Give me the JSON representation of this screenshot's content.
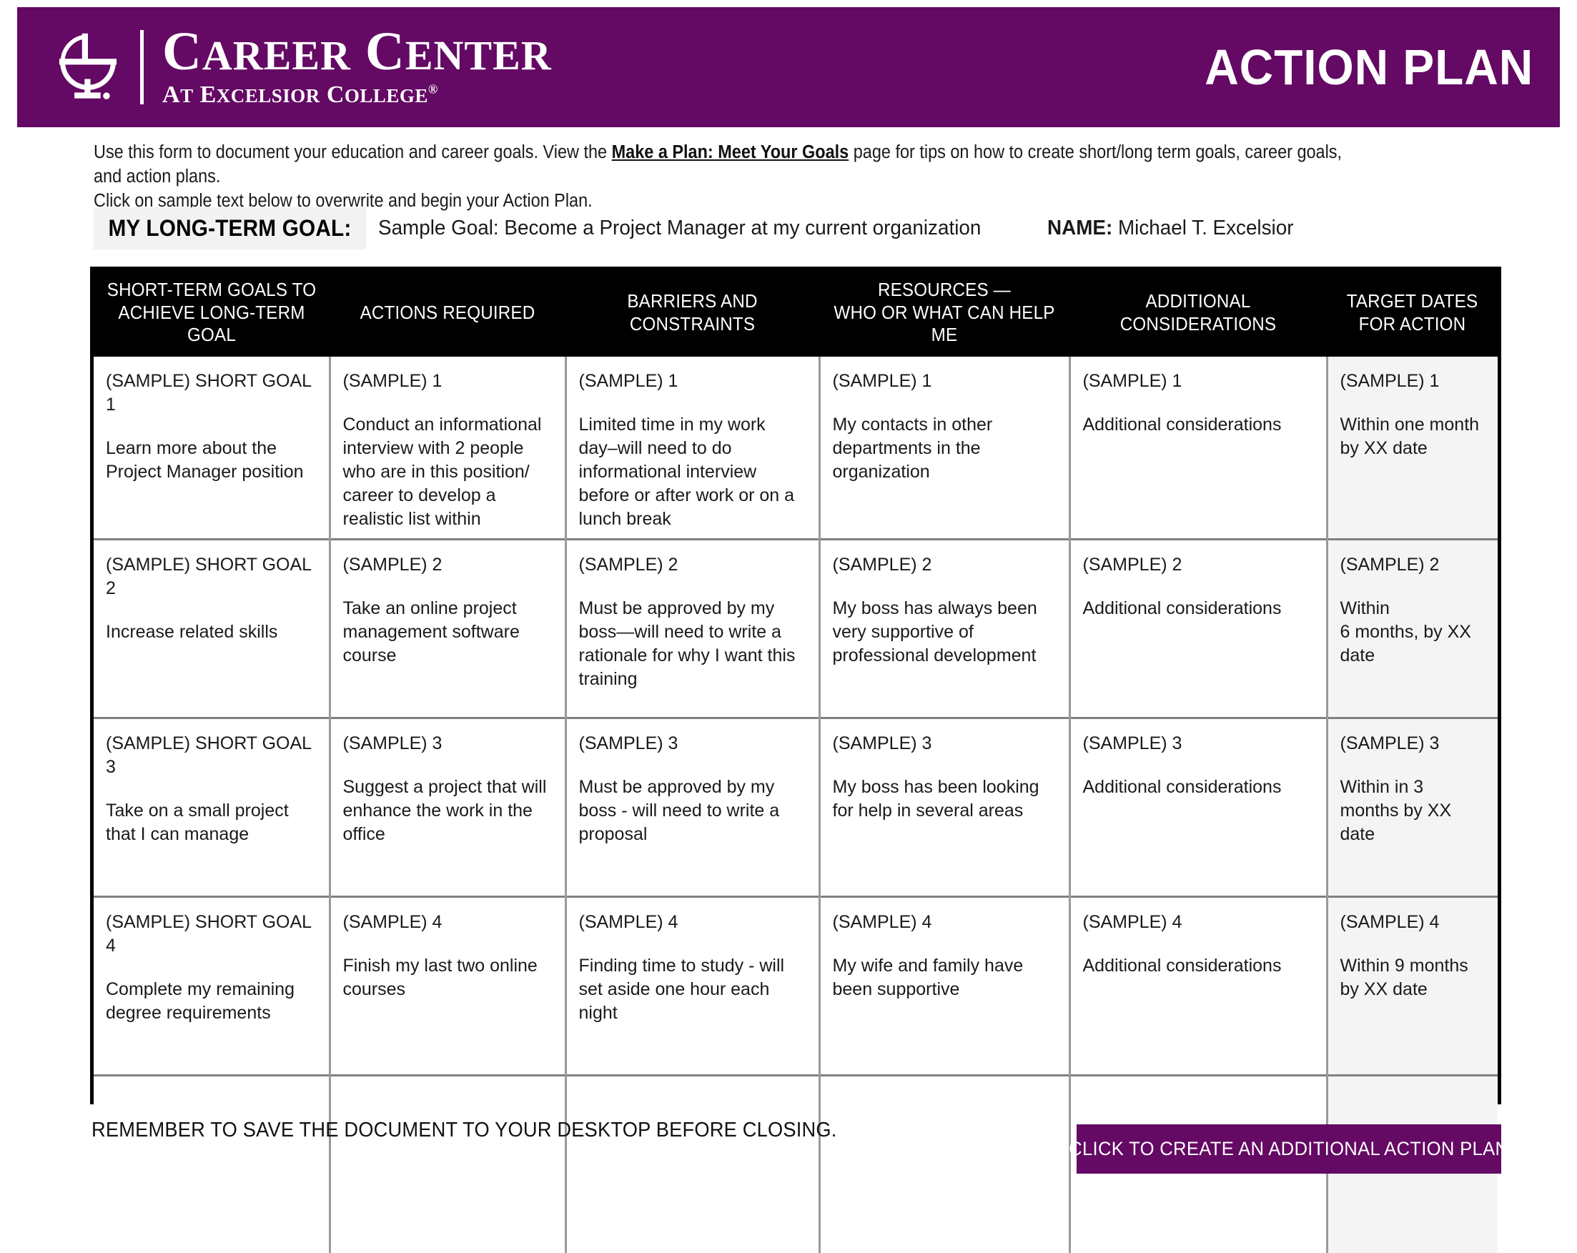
{
  "header": {
    "brand_name_line1": "CAREER CENTER",
    "brand_name_sub": "AT EXCELSIOR COLLEGE",
    "brand_reg_mark": "®",
    "document_title": "ACTION PLAN",
    "banner_color": "#640964",
    "logo_icon": "lamp-of-knowledge-icon"
  },
  "intro": {
    "line1_before_link": "Use this form to document your education and career goals. View the ",
    "link_text": "Make a Plan: Meet Your Goals",
    "line1_after_link": " page for tips on how to create short/long term goals, career goals, and action plans.",
    "line2": "Click on sample text below to overwrite and begin your Action Plan."
  },
  "goal": {
    "label": "MY LONG-TERM GOAL:",
    "value": "Sample Goal: Become a Project Manager at my current organization",
    "name_label": "NAME:",
    "name_value": "Michael T. Excelsior"
  },
  "table": {
    "headers": [
      {
        "line1": "SHORT-TERM GOALS TO",
        "line2": "ACHIEVE LONG-TERM GOAL"
      },
      {
        "line1": "ACTIONS REQUIRED",
        "line2": ""
      },
      {
        "line1": "BARRIERS AND CONSTRAINTS",
        "line2": ""
      },
      {
        "line1": "RESOURCES —",
        "line2": "WHO OR WHAT CAN HELP ME"
      },
      {
        "line1": "ADDITIONAL CONSIDERATIONS",
        "line2": ""
      },
      {
        "line1": "TARGET DATES",
        "line2": "FOR ACTION"
      }
    ],
    "rows": [
      {
        "c1_tag": "(SAMPLE) SHORT GOAL 1",
        "c1_body": "Learn more about the Project Manager position",
        "c2_tag": "(SAMPLE) 1",
        "c2_body": "Conduct an informational interview with 2 people who are in this position/ career to develop a realistic list within",
        "c3_tag": "(SAMPLE) 1",
        "c3_body": "Limited time in my work day–will need to do informational interview before or after work or on a lunch break",
        "c4_tag": "(SAMPLE) 1",
        "c4_body": "My contacts in other departments in the organization",
        "c5_tag": "(SAMPLE) 1",
        "c5_body": "Additional considerations",
        "c6_tag": "(SAMPLE) 1",
        "c6_body": "Within one month by XX date"
      },
      {
        "c1_tag": "(SAMPLE) SHORT GOAL 2",
        "c1_body": "Increase related skills",
        "c2_tag": "(SAMPLE) 2",
        "c2_body": "Take an online project management software course",
        "c3_tag": "(SAMPLE) 2",
        "c3_body": "Must be approved by my boss—will need to write a rationale for why I want this training",
        "c4_tag": "(SAMPLE) 2",
        "c4_body": "My boss has always been very supportive of professional development",
        "c5_tag": "(SAMPLE) 2",
        "c5_body": "Additional considerations",
        "c6_tag": "(SAMPLE) 2",
        "c6_body": "Within\n6 months, by XX date"
      },
      {
        "c1_tag": "(SAMPLE) SHORT GOAL 3",
        "c1_body": "Take on a small project that I can manage",
        "c2_tag": "(SAMPLE) 3",
        "c2_body": "Suggest a project that will enhance the work in the office",
        "c3_tag": "(SAMPLE) 3",
        "c3_body": "Must be approved by my boss - will need to write a proposal",
        "c4_tag": "(SAMPLE) 3",
        "c4_body": "My boss has been looking for help in several areas",
        "c5_tag": "(SAMPLE) 3",
        "c5_body": "Additional considerations",
        "c6_tag": "(SAMPLE) 3",
        "c6_body": "Within in 3 months by XX date"
      },
      {
        "c1_tag": "(SAMPLE) SHORT GOAL 4",
        "c1_body": "Complete my remaining degree requirements",
        "c2_tag": "(SAMPLE) 4",
        "c2_body": "Finish my last two online courses",
        "c3_tag": "(SAMPLE) 4",
        "c3_body": "Finding time to study - will set aside one hour each night",
        "c4_tag": "(SAMPLE) 4",
        "c4_body": "My wife and family have been supportive",
        "c5_tag": "(SAMPLE) 4",
        "c5_body": "Additional considerations",
        "c6_tag": "(SAMPLE) 4",
        "c6_body": "Within 9 months by XX date"
      },
      {
        "c1_tag": "",
        "c1_body": "",
        "c2_tag": "",
        "c2_body": "",
        "c3_tag": "",
        "c3_body": "",
        "c4_tag": "",
        "c4_body": "",
        "c5_tag": "",
        "c5_body": "",
        "c6_tag": "",
        "c6_body": ""
      }
    ]
  },
  "footer": {
    "note": "REMEMBER TO SAVE THE DOCUMENT TO YOUR DESKTOP BEFORE CLOSING.",
    "cta_label": "CLICK TO CREATE AN ADDITIONAL ACTION PLAN",
    "cta_color": "#640964"
  }
}
